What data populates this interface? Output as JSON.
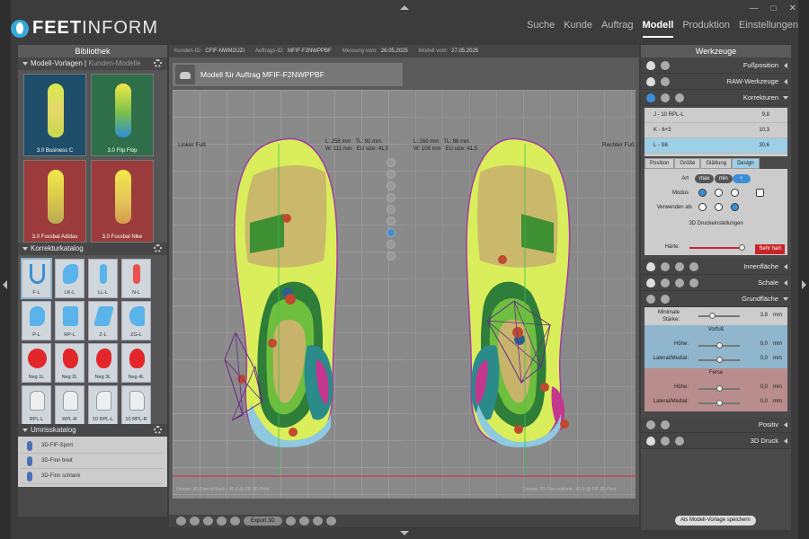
{
  "window": {
    "controls": [
      "—",
      "□",
      "✕"
    ]
  },
  "logo": {
    "bold": "FEET",
    "rest": "INFORM"
  },
  "nav": {
    "items": [
      {
        "label": "Suche",
        "active": false
      },
      {
        "label": "Kunde",
        "active": false
      },
      {
        "label": "Auftrag",
        "active": false
      },
      {
        "label": "Modell",
        "active": true
      },
      {
        "label": "Produktion",
        "active": false
      },
      {
        "label": "Einstellungen",
        "active": false
      }
    ]
  },
  "left": {
    "title": "Bibliothek",
    "templates": {
      "header": "Modell-Vorlagen",
      "header_alt": "Kunden-Modelle",
      "items": [
        {
          "label": "3.0 Business C",
          "bg": "#1f4e6b"
        },
        {
          "label": "3.0 Flip Flop",
          "bg": "#2e6f4a"
        },
        {
          "label": "3.0 Fussbal Adidas",
          "bg": "#9b3b3b"
        },
        {
          "label": "3.0 Fussbal Nike",
          "bg": "#9b3b3b"
        }
      ]
    },
    "katalog": {
      "header": "Korrekturkatalog",
      "items": [
        "F-L",
        "LK-L",
        "LL-L",
        "N-L",
        "P-L",
        "RP-L",
        "Z-L",
        "ZG-L",
        "Neg 1L",
        "Neg 2L",
        "Neg 3L",
        "Neg 4L",
        "RPL-L",
        "RPL-R",
        "10 RPL-L",
        "10 RPL-R"
      ]
    },
    "umriss": {
      "header": "Umrisskatalog",
      "items": [
        "3D-FIF-Sport",
        "3D-Finn breit",
        "3D-Finn schlank"
      ]
    }
  },
  "center": {
    "info": [
      {
        "label": "Kunden-ID:",
        "value": "CFIF-NWM2IJZI"
      },
      {
        "label": "Auftrags-ID:",
        "value": "MFIF-F2NWPPBF"
      },
      {
        "label": "Messung vom:",
        "value": "26.05.2025"
      },
      {
        "label": "Modell vom:",
        "value": "27.05.2025"
      }
    ],
    "model_title": "Modell für Auftrag  MFIF-F2NWPPBF",
    "left_foot": {
      "label": "Linker Fuß",
      "l": "L: 258 mm",
      "w": "W: 111 mm",
      "tl": "TL: 92 mm",
      "eu": "EU size: 41,0",
      "footer": "Umriss: 3D-Finn schlank - 42,0 @ FIF 3D Print"
    },
    "right_foot": {
      "label": "Rechter Fuß",
      "l": "L: 260 mm",
      "w": "W: 108 mm",
      "tl": "TL: 88 mm",
      "eu": "EU size: 41,5",
      "footer": "Umriss: 3D-Finn schlank - 42,0 @ FIF 3D Print"
    },
    "export_label": "Export 3D"
  },
  "right": {
    "title": "Werkzeuge",
    "rows": {
      "fuss": "Fußposition",
      "raw": "RAW-Werkzeuge",
      "korr": "Korrekturen",
      "innen": "Innenfläche",
      "schale": "Schale",
      "grund": "Grundfläche",
      "positiv": "Positiv",
      "druck": "3D Druck"
    },
    "corrections": [
      {
        "name": "J - 10 RPL-L",
        "value": "9,8"
      },
      {
        "name": "K - 6+3",
        "value": "10,3"
      },
      {
        "name": "L - S6",
        "value": "30,6"
      }
    ],
    "tabs": [
      "Position",
      "Größe",
      "Glättung",
      "Design"
    ],
    "design": {
      "art": "Art",
      "art_opts": [
        "max",
        "min",
        "+"
      ],
      "modus": "Modus",
      "verwenden": "Verwenden als",
      "druck": "3D Druckeinstellungen",
      "haerte": "Härte:",
      "haerte_btn": "Sehr hart"
    },
    "grund": {
      "min_label": "Minimale Stärke:",
      "min_value": "3,8",
      "unit": "mm",
      "vorfuss": {
        "title": "Vorfuß",
        "hoehe": "Höhe:",
        "hoehe_val": "0,0",
        "lat": "Lateral/Medial:",
        "lat_val": "0,0"
      },
      "ferse": {
        "title": "Ferse",
        "hoehe": "Höhe:",
        "hoehe_val": "0,0",
        "lat": "Lateral/Medial:",
        "lat_val": "0,0"
      }
    },
    "save_label": "Als Modell-Vorlage speichern"
  }
}
